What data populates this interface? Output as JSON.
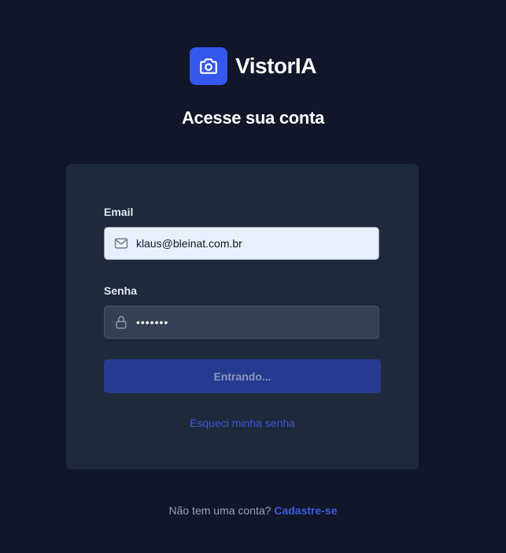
{
  "brand": {
    "name": "VistorIA",
    "logo_icon": "camera-icon",
    "accent_color": "#3457ee"
  },
  "page": {
    "title": "Acesse sua conta"
  },
  "form": {
    "email": {
      "label": "Email",
      "value": "klaus@bleinat.com.br",
      "icon": "mail-icon"
    },
    "password": {
      "label": "Senha",
      "masked_value": "•••••••",
      "icon": "lock-icon"
    },
    "submit_label": "Entrando...",
    "forgot_label": "Esqueci minha senha"
  },
  "footer": {
    "prompt": "Não tem uma conta? ",
    "signup_label": "Cadastre-se"
  }
}
